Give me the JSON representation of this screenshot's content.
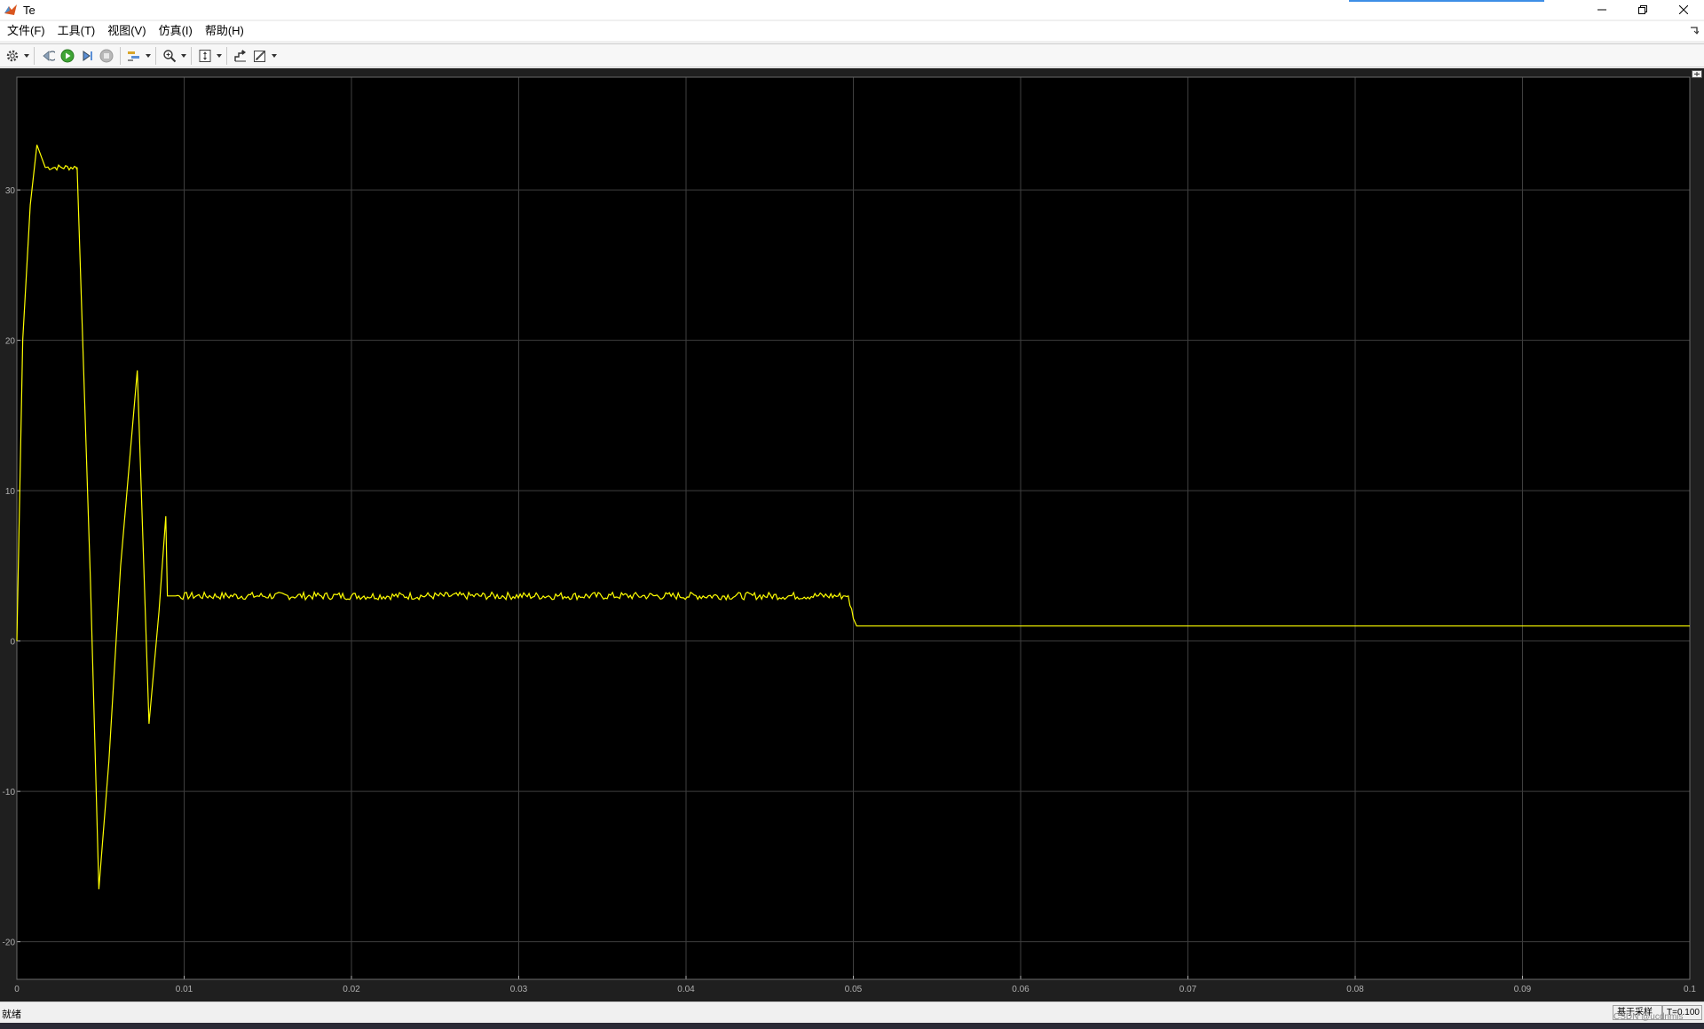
{
  "window": {
    "title": "Te"
  },
  "menu": [
    "文件(F)",
    "工具(T)",
    "视图(V)",
    "仿真(I)",
    "帮助(H)"
  ],
  "toolbar": {
    "buttons": [
      "settings-icon",
      "step-back-icon",
      "run-icon",
      "step-forward-icon",
      "stop-icon",
      "highlight-icon",
      "zoom-icon",
      "autoscale-icon",
      "restore-icon",
      "edit-icon"
    ]
  },
  "status": {
    "left": "就绪",
    "mode": "基于采样",
    "time": "T=0.100"
  },
  "watermark": "CSDN @ucdnmis",
  "colors": {
    "background": "#000000",
    "trace": "#ffff00",
    "grid": "#3f3f3f",
    "axis": "#b0b0b0",
    "frame": "#1f1f1f"
  },
  "chart_data": {
    "type": "line",
    "title": "",
    "xlabel": "",
    "ylabel": "",
    "xlim": [
      0,
      0.1
    ],
    "ylim": [
      -22.5,
      37.5
    ],
    "xticks": [
      0,
      0.01,
      0.02,
      0.03,
      0.04,
      0.05,
      0.06,
      0.07,
      0.08,
      0.09,
      0.1
    ],
    "xtick_labels": [
      "0",
      "0.01",
      "0.02",
      "0.03",
      "0.04",
      "0.05",
      "0.06",
      "0.07",
      "0.08",
      "0.09",
      "0.1"
    ],
    "yticks": [
      -20,
      -10,
      0,
      10,
      20,
      30
    ],
    "ytick_labels": [
      "-20",
      "-10",
      "0",
      "10",
      "20",
      "30"
    ],
    "grid": true,
    "series": [
      {
        "color": "#ffff00",
        "x": [
          0,
          0.00035,
          0.0008,
          0.0012,
          0.0017,
          0.00175,
          0.00355,
          0.0036,
          0.0044,
          0.0049,
          0.0055,
          0.0062,
          0.0072,
          0.0079,
          0.0085,
          0.0089,
          0.009,
          0.0095,
          0.0494,
          0.0497,
          0.05,
          0.0502,
          0.1
        ],
        "y": [
          0,
          20,
          29,
          33,
          31.5,
          31.5,
          31.5,
          31.5,
          4,
          -16.5,
          -8,
          5,
          18,
          -5.5,
          2,
          8.3,
          3,
          3,
          3,
          3,
          1.5,
          1,
          1
        ]
      }
    ],
    "noise": [
      {
        "x_from": 0.0017,
        "x_to": 0.0036,
        "amplitude": 0.2
      },
      {
        "x_from": 0.0092,
        "x_to": 0.05,
        "amplitude": 0.25
      },
      {
        "x_from": 0.0504,
        "x_to": 0.1,
        "amplitude": 0.25
      }
    ]
  }
}
